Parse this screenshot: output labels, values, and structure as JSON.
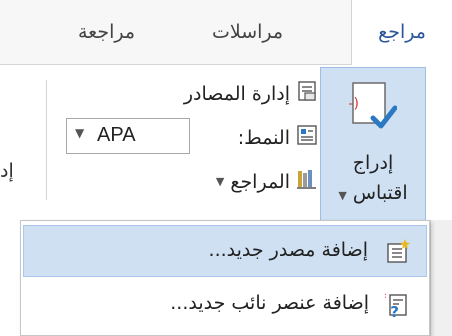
{
  "tabs": [
    {
      "label": "مراجعة"
    },
    {
      "label": "مراسلات"
    },
    {
      "label": "مراجع"
    }
  ],
  "ribbon": {
    "insert_citation": {
      "line1": "إدراج",
      "line2": "اقتباس"
    },
    "manage_sources": "إدارة المصادر",
    "style_label": "النمط:",
    "style_value": "APA",
    "bibliography": "المراجع",
    "truncated_left": "إد"
  },
  "menu": {
    "items": [
      {
        "label": "إضافة مصدر جديد..."
      },
      {
        "label": "إضافة عنصر نائب جديد..."
      }
    ]
  },
  "colors": {
    "accent": "#2b579a",
    "highlight": "#cfe0f3"
  }
}
